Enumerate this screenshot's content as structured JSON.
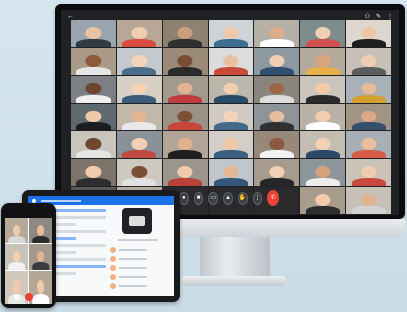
{
  "meeting": {
    "back_glyph": "←",
    "title": "",
    "recording_indicator": "",
    "top_icons": [
      "people-icon",
      "chat-icon",
      "more-icon"
    ]
  },
  "participants": [
    {
      "bg": "#9aa5ad",
      "skin": "#e8c3a4",
      "shirt": "#2f3b45"
    },
    {
      "bg": "#b8a797",
      "skin": "#f1cdb0",
      "shirt": "#d84b3d"
    },
    {
      "bg": "#8f8170",
      "skin": "#c9a07f",
      "shirt": "#303030"
    },
    {
      "bg": "#cfd3d6",
      "skin": "#f0c8a8",
      "shirt": "#3c6e91"
    },
    {
      "bg": "#b5b0a6",
      "skin": "#dcae8a",
      "shirt": "#ffffff"
    },
    {
      "bg": "#7f8c8d",
      "skin": "#f2d0b4",
      "shirt": "#d05050"
    },
    {
      "bg": "#ddd7cf",
      "skin": "#ecc6a6",
      "shirt": "#1e1e1e"
    },
    {
      "bg": "#a99a87",
      "skin": "#8d5a3b",
      "shirt": "#e6e6e6"
    },
    {
      "bg": "#c4c9cd",
      "skin": "#f4d3b8",
      "shirt": "#4a6d8c"
    },
    {
      "bg": "#9a8a78",
      "skin": "#7a4e35",
      "shirt": "#2a2a2a"
    },
    {
      "bg": "#dcdcdc",
      "skin": "#e9c0a0",
      "shirt": "#c84b3a"
    },
    {
      "bg": "#8e9aa2",
      "skin": "#f1cfb2",
      "shirt": "#2f4f6f"
    },
    {
      "bg": "#b4aa9c",
      "skin": "#d9a57e",
      "shirt": "#e8b04a"
    },
    {
      "bg": "#c7c0b6",
      "skin": "#f0cdb2",
      "shirt": "#5d5d5d"
    },
    {
      "bg": "#7c7f83",
      "skin": "#6d452f",
      "shirt": "#f0f0f0"
    },
    {
      "bg": "#d6d0c6",
      "skin": "#f3d2b6",
      "shirt": "#3b5b7a"
    },
    {
      "bg": "#a39a8e",
      "skin": "#e2b492",
      "shirt": "#bf3d3d"
    },
    {
      "bg": "#bdb6ab",
      "skin": "#f2cdae",
      "shirt": "#264b6b"
    },
    {
      "bg": "#8a857d",
      "skin": "#9a6646",
      "shirt": "#dddddd"
    },
    {
      "bg": "#ccc5bb",
      "skin": "#f1cbab",
      "shirt": "#2b2b2b"
    },
    {
      "bg": "#a7b1b7",
      "skin": "#e6bb98",
      "shirt": "#d4a02f"
    },
    {
      "bg": "#5e6a70",
      "skin": "#f0c9aa",
      "shirt": "#1d1d1d"
    },
    {
      "bg": "#c2b8aa",
      "skin": "#e3b593",
      "shirt": "#e9e9e9"
    },
    {
      "bg": "#9b9186",
      "skin": "#7c5038",
      "shirt": "#c9463c"
    },
    {
      "bg": "#d1cbc3",
      "skin": "#f4d4b9",
      "shirt": "#42698a"
    },
    {
      "bg": "#8f9498",
      "skin": "#e7bd9b",
      "shirt": "#303030"
    },
    {
      "bg": "#b9b2a7",
      "skin": "#f1ccad",
      "shirt": "#ffffff"
    },
    {
      "bg": "#a29483",
      "skin": "#dba987",
      "shirt": "#36506b"
    },
    {
      "bg": "#c9c4bc",
      "skin": "#6f472f",
      "shirt": "#e5e5e5"
    },
    {
      "bg": "#8b9297",
      "skin": "#f2cfb3",
      "shirt": "#c24b41"
    },
    {
      "bg": "#b0a596",
      "skin": "#e1b18d",
      "shirt": "#1f1f1f"
    },
    {
      "bg": "#d3cec7",
      "skin": "#f0c8a7",
      "shirt": "#3a5f80"
    },
    {
      "bg": "#96897a",
      "skin": "#8a5a3e",
      "shirt": "#f2f2f2"
    },
    {
      "bg": "#c4bdb2",
      "skin": "#f3d1b5",
      "shirt": "#2b4a69"
    },
    {
      "bg": "#a8b0b5",
      "skin": "#e8be9c",
      "shirt": "#d85c4a"
    },
    {
      "bg": "#7e746a",
      "skin": "#f1cbac",
      "shirt": "#2e2e2e"
    },
    {
      "bg": "#cdc8c0",
      "skin": "#7a4f36",
      "shirt": "#e1e1e1"
    },
    {
      "bg": "#9c958b",
      "skin": "#f0cbad",
      "shirt": "#b7423a"
    },
    {
      "bg": "#c0c6ca",
      "skin": "#e4b896",
      "shirt": "#35587a"
    },
    {
      "bg": "#a69b8e",
      "skin": "#f2d0b4",
      "shirt": "#262626"
    },
    {
      "bg": "#8d969b",
      "skin": "#d7a37f",
      "shirt": "#ececec"
    },
    {
      "bg": "#cbc3b8",
      "skin": "#f1cdb0",
      "shirt": "#c94b40"
    },
    {
      "bg": "#5f5a55",
      "skin": "#f0c8a8",
      "shirt": "#1c1c1c"
    },
    {
      "bg": "#b8b0a5",
      "skin": "#e7bb98",
      "shirt": "#3e6286"
    },
    {
      "bg": "#2a2a2c",
      "skin": "#2a2a2c",
      "shirt": "#2a2a2c"
    },
    {
      "bg": "#2a2a2c",
      "skin": "#2a2a2c",
      "shirt": "#2a2a2c"
    },
    {
      "bg": "#2a2a2c",
      "skin": "#2a2a2c",
      "shirt": "#2a2a2c"
    },
    {
      "bg": "#a79b8c",
      "skin": "#f1cbac",
      "shirt": "#2d2d2d"
    },
    {
      "bg": "#c7c1b8",
      "skin": "#e2b290",
      "shirt": "#d3d3d3"
    }
  ],
  "controls": [
    {
      "name": "mic-button",
      "icon": "mic-icon",
      "glyph": "●"
    },
    {
      "name": "camera-button",
      "icon": "camera-icon",
      "glyph": "■"
    },
    {
      "name": "captions-button",
      "icon": "captions-icon",
      "glyph": "▭"
    },
    {
      "name": "present-button",
      "icon": "present-icon",
      "glyph": "▲"
    },
    {
      "name": "raise-hand-button",
      "icon": "hand-icon",
      "glyph": "✋"
    },
    {
      "name": "more-options-button",
      "icon": "more-icon",
      "glyph": "⋮"
    },
    {
      "name": "end-call-button",
      "icon": "end-call-icon",
      "glyph": "✆",
      "end": true
    }
  ],
  "phone_participants": [
    {
      "bg": "#b5a998",
      "skin": "#f0cbab",
      "shirt": "#d9d9d9"
    },
    {
      "bg": "#8d8a85",
      "skin": "#e7bc9a",
      "shirt": "#2a2a2a"
    },
    {
      "bg": "#c9c2b8",
      "skin": "#f2cfb3",
      "shirt": "#f0f0f0"
    },
    {
      "bg": "#a3998d",
      "skin": "#e3b594",
      "shirt": "#3b3b3b"
    },
    {
      "bg": "#d1c7ba",
      "skin": "#f1cbac",
      "shirt": "#e8e8e8"
    },
    {
      "bg": "#b4a697",
      "skin": "#f0c9a9",
      "shirt": "#ffffff"
    }
  ],
  "colors": {
    "meet_background": "#202124",
    "end_call_red": "#ea4335",
    "accent_blue": "#1a73e8"
  }
}
